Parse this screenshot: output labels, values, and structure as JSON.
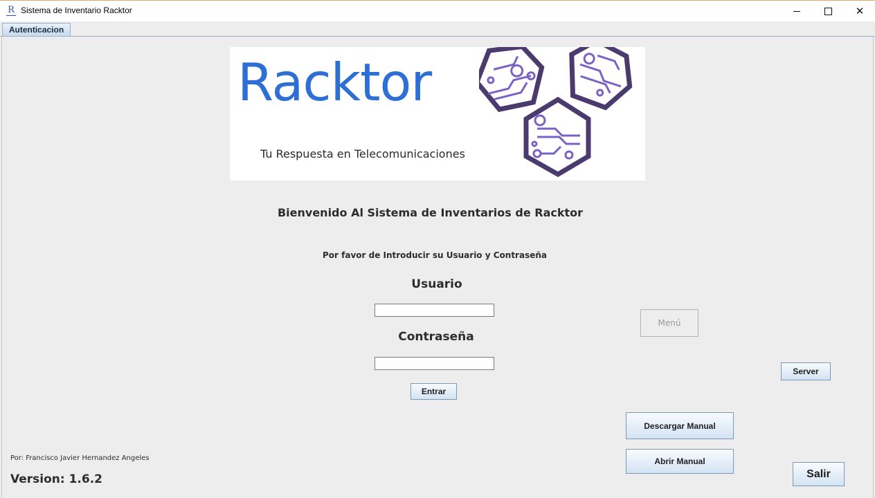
{
  "window": {
    "title": "Sistema de Inventario Racktor",
    "icon_letter": "R",
    "icons": {
      "app": "r-app-icon",
      "minimize": "minimize-icon",
      "maximize": "maximize-icon",
      "close": "close-icon"
    }
  },
  "tabs": [
    {
      "label": "Autenticacion",
      "selected": true
    }
  ],
  "banner": {
    "brand": "Racktor",
    "tagline": "Tu Respuesta en Telecomunicaciones",
    "colors": {
      "brand": "#2e6fd6",
      "hexagon": "#4a3a6e",
      "circuit": "#7a62c4"
    }
  },
  "login": {
    "welcome": "Bienvenido Al Sistema de Inventarios de Racktor",
    "instructions": "Por favor de Introducir su Usuario y Contraseña",
    "user_label": "Usuario",
    "user_value": "",
    "password_label": "Contraseña",
    "password_value": "",
    "submit_label": "Entrar"
  },
  "buttons": {
    "menu": {
      "label": "Menú",
      "enabled": false
    },
    "server": "Server",
    "download_manual": "Descargar Manual",
    "open_manual": "Abrir Manual",
    "exit": "Salir"
  },
  "footer": {
    "author": "Por: Francisco Javier Hernandez Angeles",
    "version": "Version: 1.6.2"
  }
}
